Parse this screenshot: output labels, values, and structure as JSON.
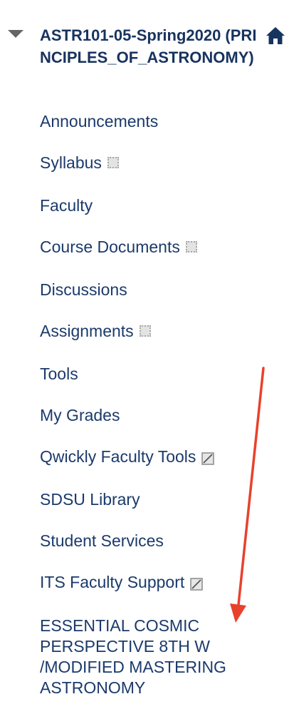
{
  "course": {
    "title": "ASTR101-05-Spring2020 (PRINCIPLES_OF_ASTRONOMY)",
    "home_icon": "home-icon",
    "toggle_icon": "triangle-down-icon"
  },
  "menu": {
    "items": [
      {
        "label": "Announcements",
        "icon": ""
      },
      {
        "label": "Syllabus",
        "icon": "hidden-status-icon"
      },
      {
        "label": "Faculty",
        "icon": ""
      },
      {
        "label": "Course Documents",
        "icon": "hidden-status-icon"
      },
      {
        "label": "Discussions",
        "icon": ""
      },
      {
        "label": "Assignments",
        "icon": "hidden-status-icon"
      },
      {
        "label": "Tools",
        "icon": ""
      },
      {
        "label": "My Grades",
        "icon": ""
      },
      {
        "label": "Qwickly Faculty Tools",
        "icon": "external-link-icon"
      },
      {
        "label": "SDSU Library",
        "icon": ""
      },
      {
        "label": "Student Services",
        "icon": ""
      },
      {
        "label": "ITS Faculty Support",
        "icon": "external-link-icon"
      }
    ],
    "last_item": {
      "lines": [
        "ESSENTIAL COSMIC",
        "PERSPECTIVE 8TH W",
        "/MODIFIED MASTERING",
        "ASTRONOMY"
      ]
    }
  },
  "annotation": {
    "type": "red-arrow",
    "color": "#e8412c"
  },
  "colors": {
    "link": "#1b3a6b",
    "title": "#17335f",
    "toggle": "#666666"
  }
}
